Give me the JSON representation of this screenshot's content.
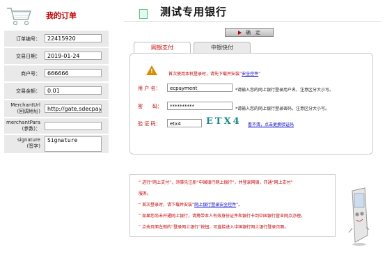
{
  "left": {
    "title": "我的订单",
    "fields": [
      {
        "label": "订单编号：",
        "value": "22415920"
      },
      {
        "label": "交易日期：",
        "value": "2019-01-24"
      },
      {
        "label": "商户号：",
        "value": "666666"
      },
      {
        "label": "交易金额：",
        "value": "0.01"
      },
      {
        "label_line1": "MerchantUrl",
        "label_line2": "(回调地址)",
        "value": "http://gate.sdecpay.com"
      },
      {
        "label_line1": "merchantPara",
        "label_line2": "(参数)：",
        "value": ""
      },
      {
        "label_line1": "signature",
        "label_line2": "(签字)",
        "value": "Signature"
      }
    ]
  },
  "main": {
    "bank_title": "测试专用银行",
    "confirm_label": "确　定",
    "tabs": [
      {
        "label": "网银支付",
        "active": true
      },
      {
        "label": "中银快付",
        "active": false
      }
    ],
    "warning": {
      "text": "首次使用本机登录时，请先下载并安装“",
      "link": "安全控件",
      "tail": "”"
    },
    "form": {
      "username_label": "用 户 名：",
      "username_value": "ecpayment",
      "username_hint": "*请输入您的网上银行登录用户名，注意区分大小写。",
      "password_label": "密　　码：",
      "password_value": "**********",
      "password_hint": "*请输入您的网上银行登录密码，注意区分大小写。",
      "captcha_label": "验 证 码：",
      "captcha_value": "etx4",
      "captcha_image_text": "ETX4",
      "captcha_refresh": "看不清，点击更换验证码"
    },
    "notes": [
      {
        "text": "“ 进行“网上支付”，须事先注册“中国银行网上银行”，并登录网银，开通“网上支付”"
      },
      {
        "text": "服务。"
      },
      {
        "text_pre": "“ 首次登录时，请下载并安装“",
        "link": "网上银行登录安全控件",
        "text_post": "”。"
      },
      {
        "text": "“ 如果您尚未开通网上银行，请携带本人有效身份证件和银行卡到中国银行营业网点办理。"
      },
      {
        "text": "“ 点击页面左侧的“登录网上银行”按钮，可直接进入中国银行网上银行登录页面。"
      }
    ]
  },
  "colors": {
    "accent": "#cc0000",
    "link": "#0000cc",
    "warn": "#e08a00"
  }
}
